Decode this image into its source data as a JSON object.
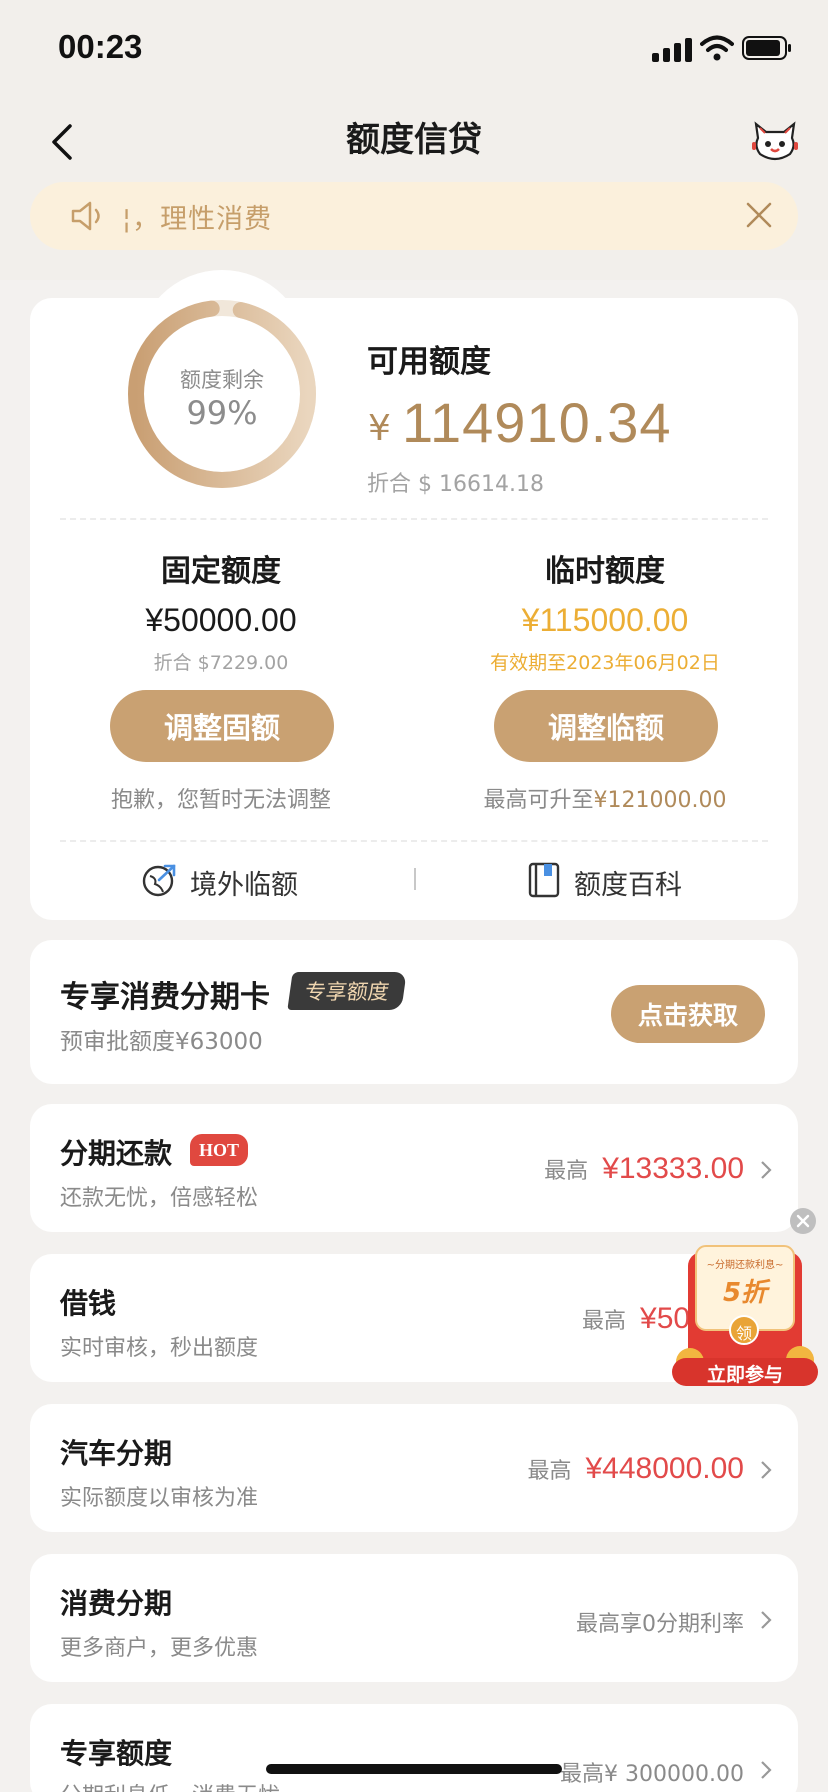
{
  "status": {
    "time": "00:23"
  },
  "nav": {
    "title": "额度信贷"
  },
  "notice": {
    "text": "¦，理性消费"
  },
  "summary": {
    "ring_label": "额度剩余",
    "ring_pct": "99%",
    "ring_fraction": 0.99,
    "avail_label": "可用额度",
    "currency": "¥",
    "avail_amount": "114910.34",
    "avail_equiv": "折合 $ 16614.18"
  },
  "fixed": {
    "title": "固定额度",
    "amount": "¥50000.00",
    "equiv": "折合 $7229.00",
    "button": "调整固额",
    "note": "抱歉，您暂时无法调整"
  },
  "temp": {
    "title": "临时额度",
    "amount": "¥115000.00",
    "valid": "有效期至2023年06月02日",
    "button": "调整临额",
    "note_prefix": "最高可升至",
    "note_amount": "¥121000.00"
  },
  "links": {
    "overseas": "境外临额",
    "wiki": "额度百科"
  },
  "exclusive": {
    "title": "专享消费分期卡",
    "badge": "专享额度",
    "sub": "预审批额度¥63000",
    "button": "点击获取"
  },
  "rows": [
    {
      "title": "分期还款",
      "badge": "HOT",
      "sub": "还款无忧，倍感轻松",
      "prefix": "最高",
      "value": "¥13333.00"
    },
    {
      "title": "借钱",
      "sub": "实时审核，秒出额度",
      "prefix": "最高",
      "value": "¥50"
    },
    {
      "title": "汽车分期",
      "sub": "实际额度以审核为准",
      "prefix": "最高",
      "value": "¥448000.00"
    },
    {
      "title": "消费分期",
      "sub": "更多商户，更多优惠",
      "text": "最高享0分期利率"
    },
    {
      "title": "专享额度",
      "sub": "分期利息低，消费无忧",
      "text": "最高¥ 300000.00"
    }
  ],
  "promo": {
    "top": "~分期还款利息~",
    "discount": "5折",
    "coin": "领",
    "button": "立即参与"
  },
  "colors": {
    "accent": "#c9a172",
    "gold_text": "#b08a5a",
    "temp_amount": "#ecae35",
    "red": "#e24a4a"
  }
}
